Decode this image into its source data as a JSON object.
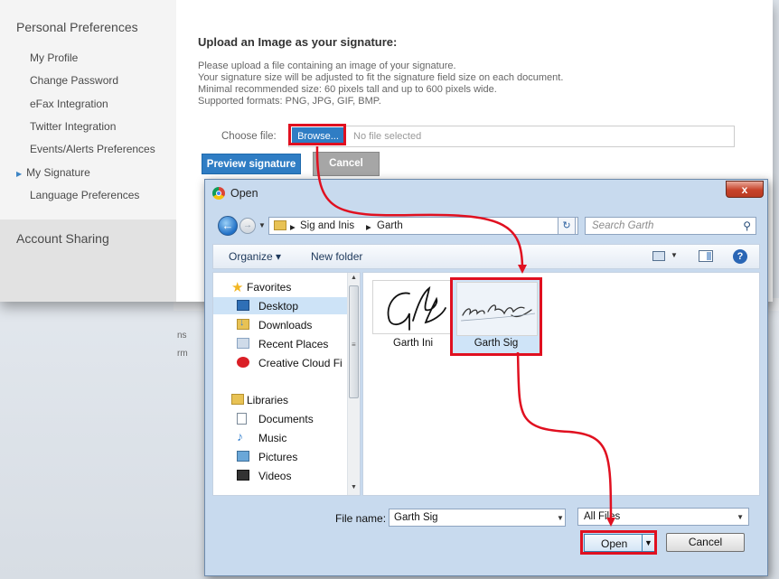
{
  "sidebar": {
    "title": "Personal Preferences",
    "items": [
      {
        "label": "My Profile"
      },
      {
        "label": "Change Password"
      },
      {
        "label": "eFax Integration"
      },
      {
        "label": "Twitter Integration"
      },
      {
        "label": "Events/Alerts Preferences"
      },
      {
        "label": "My Signature",
        "active": true
      },
      {
        "label": "Language Preferences"
      }
    ],
    "account_sharing": "Account Sharing"
  },
  "upload": {
    "title": "Upload an Image as your signature:",
    "lines": [
      "Please upload a file containing an image of your signature.",
      "Your signature size will be adjusted to fit the signature field size on each document.",
      "Minimal recommended size: 60 pixels tall and up to 600 pixels wide.",
      "Supported formats: PNG, JPG, GIF, BMP."
    ],
    "choose_label": "Choose file:",
    "browse_label": "Browse...",
    "file_status": "No file selected",
    "preview_label": "Preview signature",
    "cancel_label": "Cancel"
  },
  "background_fragments": [
    "ns",
    "rm"
  ],
  "dialog": {
    "title": "Open",
    "close_glyph": "x",
    "path": [
      "Sig and Inis",
      "Garth"
    ],
    "search_placeholder": "Search Garth",
    "organize_label": "Organize ▾",
    "new_folder_label": "New folder",
    "nav": [
      {
        "label": "Favorites",
        "icon": "star-icon",
        "color": "#f2b623"
      },
      {
        "label": "Desktop",
        "icon": "desktop-icon",
        "color": "#2f6fb6",
        "selected": true
      },
      {
        "label": "Downloads",
        "icon": "downloads-icon",
        "color": "#3d84d0"
      },
      {
        "label": "Recent Places",
        "icon": "recent-places-icon",
        "color": "#8aa4c2"
      },
      {
        "label": "Creative Cloud Fi",
        "icon": "creative-cloud-icon",
        "color": "#da1f26"
      },
      {
        "label": "Libraries",
        "icon": "libraries-icon",
        "color": "#e8c254"
      },
      {
        "label": "Documents",
        "icon": "documents-icon",
        "color": "#ffffff"
      },
      {
        "label": "Music",
        "icon": "music-icon",
        "color": "#3d84d0"
      },
      {
        "label": "Pictures",
        "icon": "pictures-icon",
        "color": "#6aa7d8"
      },
      {
        "label": "Videos",
        "icon": "videos-icon",
        "color": "#333333"
      }
    ],
    "files": [
      {
        "name": "Garth Ini"
      },
      {
        "name": "Garth Sig",
        "selected": true
      }
    ],
    "file_name_label": "File name:",
    "file_name_value": "Garth Sig",
    "file_type_value": "All Files",
    "open_label": "Open",
    "cancel_label": "Cancel"
  },
  "colors": {
    "accent_blue": "#2f7dc4",
    "highlight_red": "#e01020"
  }
}
